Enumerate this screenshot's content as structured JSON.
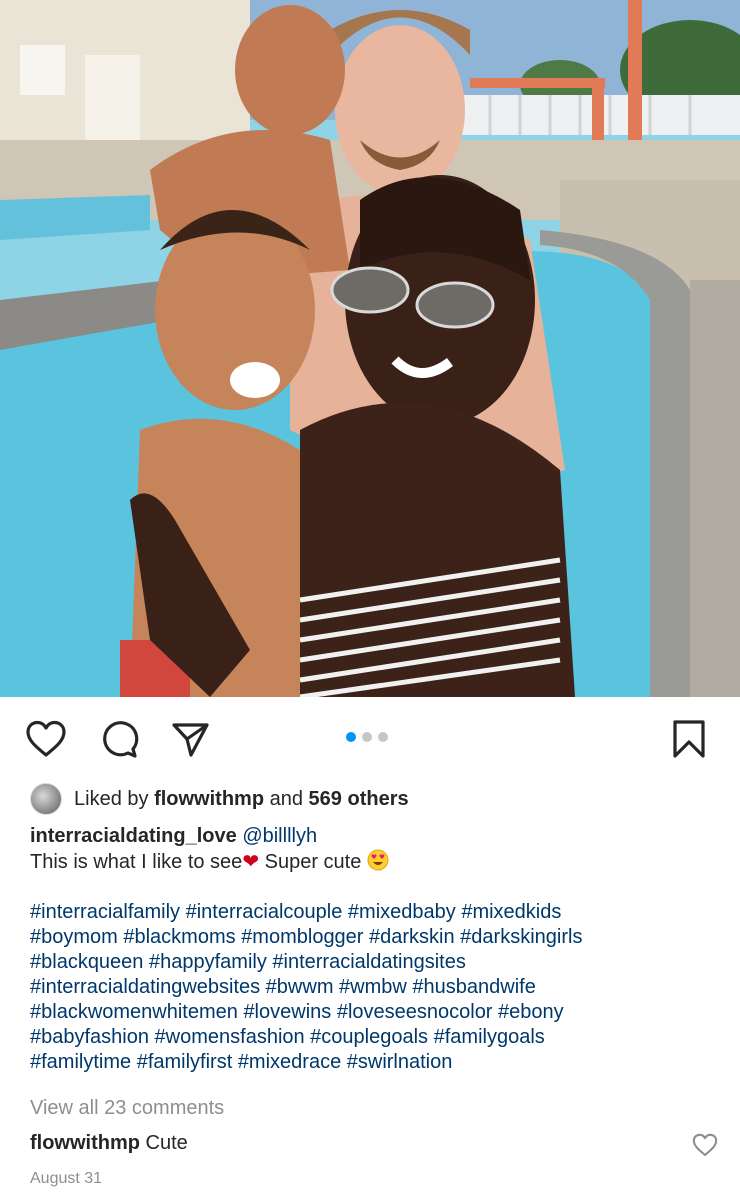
{
  "post": {
    "image_alt": "Family smiling together in a swimming pool",
    "carousel": {
      "count": 3,
      "active_index": 0
    },
    "liked_by": {
      "prefix": "Liked by",
      "user": "flowwithmp",
      "conjunction": "and",
      "others": "569 others"
    },
    "caption": {
      "username": "interracialdating_love",
      "mention": "@billllyh",
      "line1_text": "This is what I like to see",
      "heart_emoji": "❤",
      "line1_tail": " Super cute",
      "hashtags": [
        "#interracialfamily #interracialcouple #mixedbaby #mixedkids",
        "#boymom #blackmoms #momblogger #darkskin #darkskingirls",
        "#blackqueen #happyfamily #interracialdatingsites",
        "#interracialdatingwebsites #bwwm #wmbw #husbandwife",
        "#blackwomenwhitemen #lovewins #loveseesnocolor #ebony",
        "#babyfashion #womensfashion #couplegoals #familygoals",
        "#familytime #familyfirst #mixedrace #swirlnation"
      ]
    },
    "view_comments": "View all 23 comments",
    "top_comment": {
      "user": "flowwithmp",
      "text": "Cute"
    },
    "date": "August 31"
  },
  "icons": {
    "like": "heart-outline-icon",
    "comment": "comment-bubble-icon",
    "share": "paper-plane-icon",
    "save": "bookmark-icon"
  },
  "colors": {
    "link": "#00376b",
    "muted": "#8e8e8e",
    "carousel_active": "#0095f6",
    "carousel_inactive": "#c7c7c7"
  }
}
